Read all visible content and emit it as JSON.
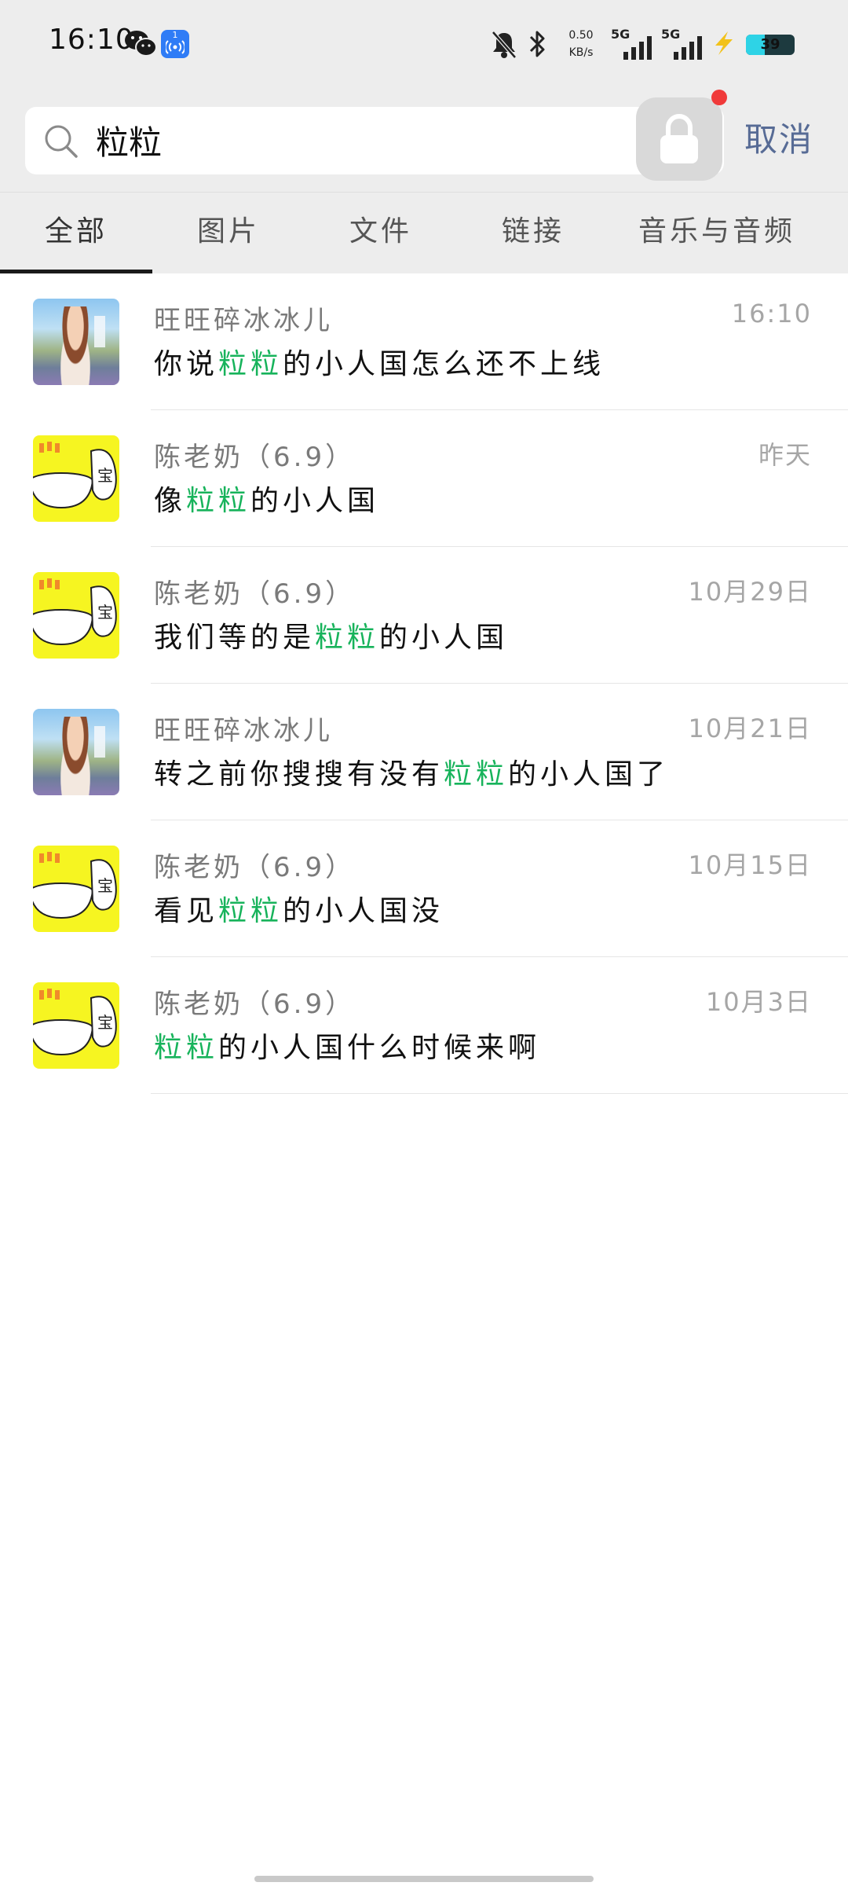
{
  "status_bar": {
    "time": "16:10",
    "hotspot_badge": "1",
    "net_speed_value": "0.50",
    "net_speed_unit": "KB/s",
    "sim1_label": "5G",
    "sim2_label": "5G",
    "battery_percent": "39",
    "battery_level": 0.39
  },
  "search": {
    "query": "粒粒",
    "cancel_label": "取消"
  },
  "tabs": [
    {
      "label": "全部",
      "active": true
    },
    {
      "label": "图片",
      "active": false
    },
    {
      "label": "文件",
      "active": false
    },
    {
      "label": "链接",
      "active": false
    },
    {
      "label": "音乐与音频",
      "active": false
    }
  ],
  "results": [
    {
      "name": "旺旺碎冰冰儿",
      "date": "16:10",
      "avatar": "photo",
      "before": "你说",
      "highlight": "粒粒",
      "after": "的小人国怎么还不上线"
    },
    {
      "name": "陈老奶（6.9）",
      "date": "昨天",
      "avatar": "cartoon",
      "before": "像",
      "highlight": "粒粒",
      "after": "的小人国"
    },
    {
      "name": "陈老奶（6.9）",
      "date": "10月29日",
      "avatar": "cartoon",
      "before": "我们等的是",
      "highlight": "粒粒",
      "after": "的小人国"
    },
    {
      "name": "旺旺碎冰冰儿",
      "date": "10月21日",
      "avatar": "photo",
      "before": "转之前你搜搜有没有",
      "highlight": "粒粒",
      "after": "的小人国了"
    },
    {
      "name": "陈老奶（6.9）",
      "date": "10月15日",
      "avatar": "cartoon",
      "before": "看见",
      "highlight": "粒粒",
      "after": "的小人国没"
    },
    {
      "name": "陈老奶（6.9）",
      "date": "10月3日",
      "avatar": "cartoon",
      "before": "",
      "highlight": "粒粒",
      "after": "的小人国什么时候来啊"
    }
  ],
  "colors": {
    "highlight": "#17b35b",
    "cancel": "#576b95",
    "top_background": "#ededed"
  }
}
